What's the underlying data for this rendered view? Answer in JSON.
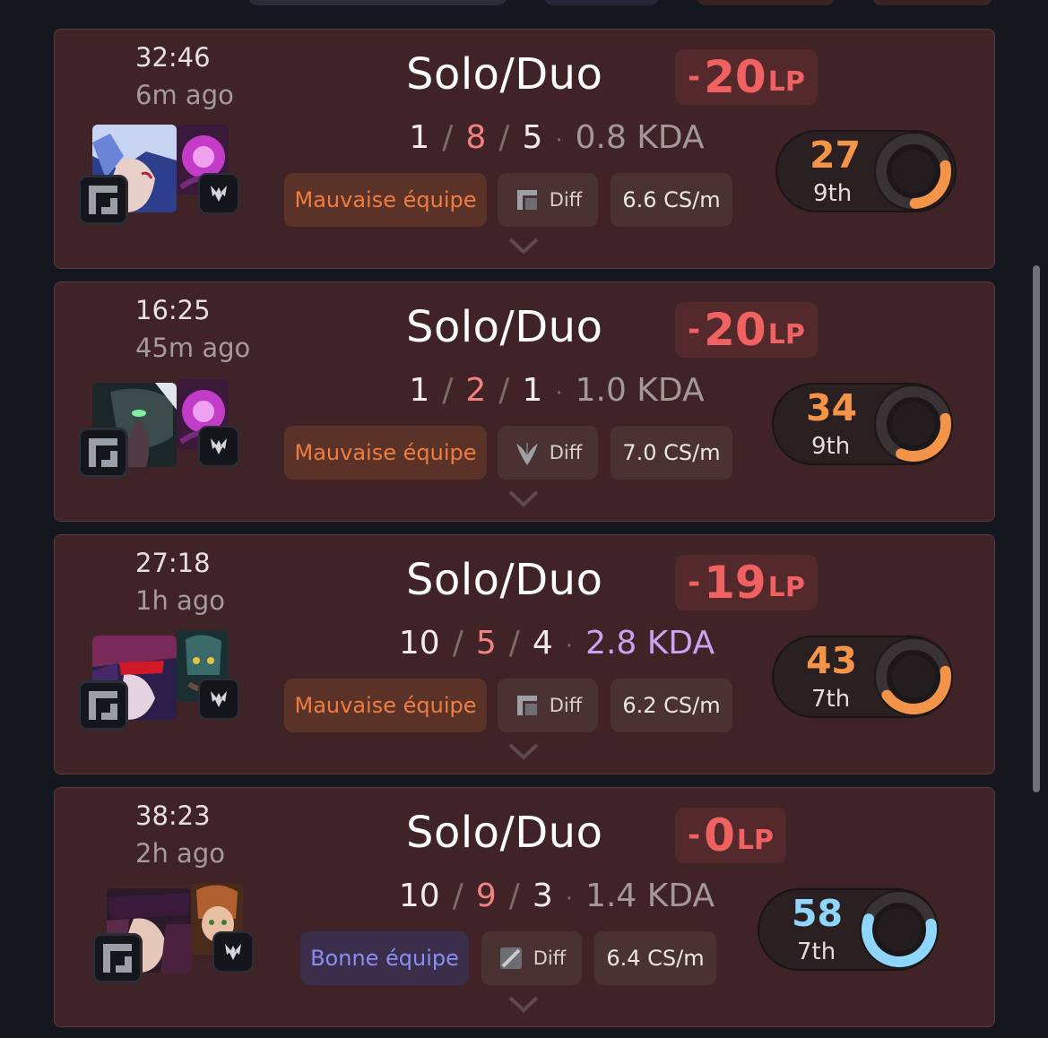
{
  "colors": {
    "loss": "#f06262",
    "bad_team": "#ef7d40",
    "good_team": "#8a8df4",
    "score_orange": "#f39449",
    "score_blue": "#8fd6ff",
    "kda_good": "#c6a4f2"
  },
  "icons": {
    "role": "square-bracket-icon",
    "keystone": "wings-icon",
    "diff_a": "square-diff-icon",
    "diff_b": "leaf-diff-icon",
    "diff_c": "slash-diff-icon",
    "expand": "chevron-down-icon"
  },
  "matches": [
    {
      "duration": "32:46",
      "ago": "6m ago",
      "queue": "Solo/Duo",
      "lp_sign": "-",
      "lp_value": "20",
      "lp_unit": "LP",
      "kills": "1",
      "deaths": "8",
      "assists": "5",
      "kda": "0.8 KDA",
      "team_tag": "Mauvaise équipe",
      "diff": "Diff",
      "cs": "6.6 CS/m",
      "score": "27",
      "place": "9th",
      "score_fraction": 0.27
    },
    {
      "duration": "16:25",
      "ago": "45m ago",
      "queue": "Solo/Duo",
      "lp_sign": "-",
      "lp_value": "20",
      "lp_unit": "LP",
      "kills": "1",
      "deaths": "2",
      "assists": "1",
      "kda": "1.0 KDA",
      "team_tag": "Mauvaise équipe",
      "diff": "Diff",
      "cs": "7.0 CS/m",
      "score": "34",
      "place": "9th",
      "score_fraction": 0.34
    },
    {
      "duration": "27:18",
      "ago": "1h ago",
      "queue": "Solo/Duo",
      "lp_sign": "-",
      "lp_value": "19",
      "lp_unit": "LP",
      "kills": "10",
      "deaths": "5",
      "assists": "4",
      "kda": "2.8 KDA",
      "team_tag": "Mauvaise équipe",
      "diff": "Diff",
      "cs": "6.2 CS/m",
      "score": "43",
      "place": "7th",
      "score_fraction": 0.43
    },
    {
      "duration": "38:23",
      "ago": "2h ago",
      "queue": "Solo/Duo",
      "lp_sign": "-",
      "lp_value": "0",
      "lp_unit": "LP",
      "kills": "10",
      "deaths": "9",
      "assists": "3",
      "kda": "1.4 KDA",
      "team_tag": "Bonne équipe",
      "diff": "Diff",
      "cs": "6.4 CS/m",
      "score": "58",
      "place": "7th",
      "score_fraction": 0.58
    }
  ]
}
